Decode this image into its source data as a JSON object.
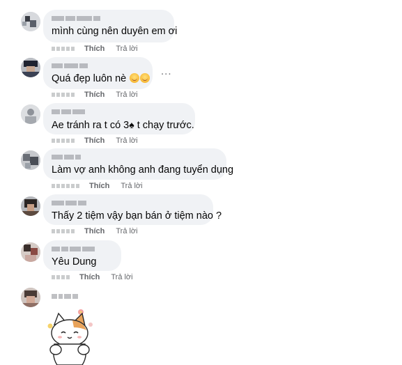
{
  "actions": {
    "like": "Thích",
    "reply": "Trả lời",
    "more": "..."
  },
  "comments": [
    {
      "text": "mình cùng nên duyên em ơi"
    },
    {
      "text": "Quá đẹp luôn nè",
      "emoji": "smiling-face-icon"
    },
    {
      "text_before": "Ae tránh ra t có 3",
      "symbol": "♠",
      "text_after": " t chạy trước."
    },
    {
      "text": "Làm vợ anh không anh đang tuyển dụng"
    },
    {
      "text": "Thấy 2 tiệm vậy bạn bán ở tiệm nào ?"
    },
    {
      "text": "Yêu Dung"
    },
    {
      "text": ""
    }
  ],
  "sticker": {
    "icon": "cat-sticker-icon"
  },
  "colors": {
    "bubble": "#f0f2f5",
    "meta": "#65676b",
    "text": "#050505"
  }
}
